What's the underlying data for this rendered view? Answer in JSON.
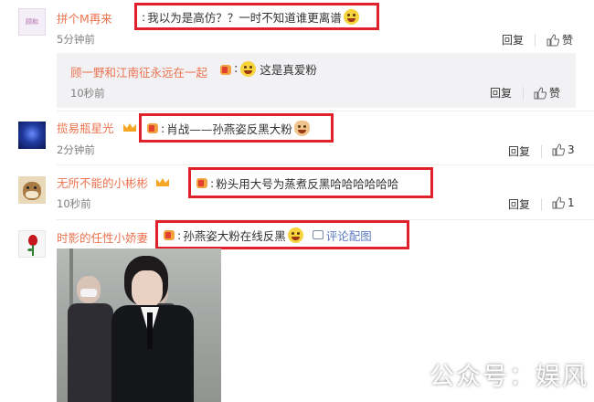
{
  "comments": [
    {
      "user": "拼个M再来",
      "avatar_text": "顾和",
      "text": "我以为是高仿？？一时不知道谁更离谱",
      "time": "5分钟前",
      "reply_label": "回复",
      "like_label": "赞",
      "reply": {
        "user": "顾一野和江南征永远在一起",
        "text": "这是真爱粉",
        "time": "10秒前",
        "reply_label": "回复",
        "like_label": "赞"
      }
    },
    {
      "user": "揽易瓶星光",
      "text": "肖战——孙燕姿反黑大粉",
      "time": "2分钟前",
      "reply_label": "回复",
      "like_count": "3"
    },
    {
      "user": "无所不能的小彬彬",
      "text": "粉头用大号为蒸煮反黑哈哈哈哈哈哈",
      "time": "10秒前",
      "reply_label": "回复",
      "like_count": "1"
    },
    {
      "user": "时影的任性小娇妻",
      "text": "孙燕姿大粉在线反黑",
      "link_label": "评论配图"
    }
  ],
  "prefix": ":",
  "watermark": "公众号：娱风",
  "colors": {
    "username": "#eb7350",
    "highlight_border": "#e0202a",
    "reply_bg": "#f2f2f5"
  }
}
